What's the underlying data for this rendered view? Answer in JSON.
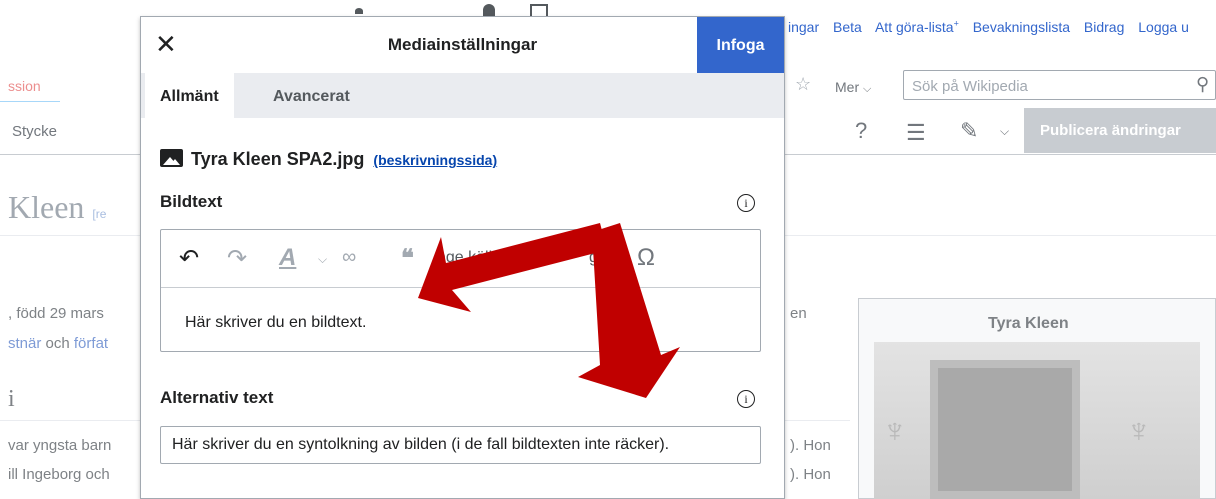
{
  "background": {
    "personal_links": [
      "ingar",
      "Beta",
      "Att göra-lista",
      "+",
      "Bevakningslista",
      "Bidrag",
      "Logga u"
    ],
    "tab_partial": "ssion",
    "more_label": "Mer",
    "search_placeholder": "Sök på Wikipedia",
    "paragraph_style": "Stycke",
    "publish_label": "Publicera ändringar",
    "heading": "Kleen",
    "heading_edit": "[re",
    "text_line1": ", född 29 mars",
    "text_link1": "stnär",
    "text_och": "och",
    "text_link2": "förfat",
    "text_right_en": "en",
    "section_heading": "i",
    "text_line3": "var yngsta barn",
    "text_line4": "ill Ingeborg och",
    "text_right3": "). Hon",
    "text_right4": "). Hon",
    "infobox_title": "Tyra Kleen"
  },
  "dialog": {
    "title": "Mediainställningar",
    "insert_label": "Infoga",
    "tabs": [
      {
        "label": "Allmänt",
        "active": true
      },
      {
        "label": "Avancerat",
        "active": false
      }
    ],
    "filename": "Tyra Kleen SPA2.jpg",
    "description_link": "(beskrivningssida)",
    "caption_label": "Bildtext",
    "caption_text": "Här skriver du en bildtext.",
    "editor_toolbar": {
      "cite_partial": "nge källa",
      "cite_partial2": "g"
    },
    "alt_label": "Alternativ text",
    "alt_text": "Här skriver du en syntolkning av bilden (i de fall bildtexten inte räcker)."
  },
  "colors": {
    "accent": "#3366cc",
    "arrow": "#c00000"
  }
}
